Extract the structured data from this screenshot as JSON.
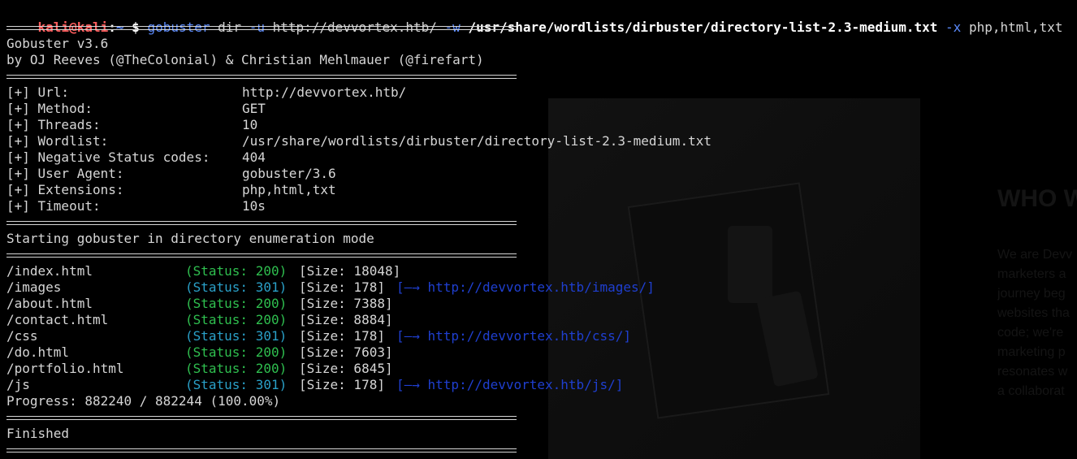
{
  "prompt": {
    "user": "kali@kali",
    "sep": ":",
    "path": "~",
    "dollar": "$",
    "command": "gobuster",
    "args": [
      {
        "text": "dir",
        "type": "arg"
      },
      {
        "text": "-u",
        "type": "flag"
      },
      {
        "text": "http://devvortex.htb/",
        "type": "arg"
      },
      {
        "text": "-w",
        "type": "flag"
      },
      {
        "text": "/usr/share/wordlists/dirbuster/directory-list-2.3-medium.txt",
        "type": "bold"
      },
      {
        "text": "-x",
        "type": "flag"
      },
      {
        "text": "php,html,txt",
        "type": "arg"
      }
    ]
  },
  "banner": {
    "line1": "Gobuster v3.6",
    "line2": "by OJ Reeves (@TheColonial) & Christian Mehlmauer (@firefart)"
  },
  "config": [
    {
      "key": "[+] Url:",
      "value": "http://devvortex.htb/"
    },
    {
      "key": "[+] Method:",
      "value": "GET"
    },
    {
      "key": "[+] Threads:",
      "value": "10"
    },
    {
      "key": "[+] Wordlist:",
      "value": "/usr/share/wordlists/dirbuster/directory-list-2.3-medium.txt"
    },
    {
      "key": "[+] Negative Status codes:",
      "value": "404"
    },
    {
      "key": "[+] User Agent:",
      "value": "gobuster/3.6"
    },
    {
      "key": "[+] Extensions:",
      "value": "php,html,txt"
    },
    {
      "key": "[+] Timeout:",
      "value": "10s"
    }
  ],
  "start_message": "Starting gobuster in directory enumeration mode",
  "results": [
    {
      "path": "/index.html",
      "status": "(Status: 200)",
      "code": "200",
      "size": "[Size: 18048]",
      "redirect": ""
    },
    {
      "path": "/images",
      "status": "(Status: 301)",
      "code": "301",
      "size": "[Size: 178]",
      "redirect": "[—→ http://devvortex.htb/images/]"
    },
    {
      "path": "/about.html",
      "status": "(Status: 200)",
      "code": "200",
      "size": "[Size: 7388]",
      "redirect": ""
    },
    {
      "path": "/contact.html",
      "status": "(Status: 200)",
      "code": "200",
      "size": "[Size: 8884]",
      "redirect": ""
    },
    {
      "path": "/css",
      "status": "(Status: 301)",
      "code": "301",
      "size": "[Size: 178]",
      "redirect": "[—→ http://devvortex.htb/css/]"
    },
    {
      "path": "/do.html",
      "status": "(Status: 200)",
      "code": "200",
      "size": "[Size: 7603]",
      "redirect": ""
    },
    {
      "path": "/portfolio.html",
      "status": "(Status: 200)",
      "code": "200",
      "size": "[Size: 6845]",
      "redirect": ""
    },
    {
      "path": "/js",
      "status": "(Status: 301)",
      "code": "301",
      "size": "[Size: 178]",
      "redirect": "[—→ http://devvortex.htb/js/]"
    }
  ],
  "progress": "Progress: 882240 / 882244 (100.00%)",
  "finished": "Finished",
  "background": {
    "heading": "WHO W",
    "para": [
      "We are Devv",
      "marketers a",
      "journey beg",
      "websites tha",
      "code; we're",
      "marketing p",
      "resonates w",
      "a collaborat"
    ]
  },
  "colors": {
    "user": "#ff5c5c",
    "path": "#5c8cff",
    "status200": "#2fbf4f",
    "status301": "#2aa0c8",
    "redirect": "#1f3fd0",
    "text": "#d6d6d6"
  }
}
